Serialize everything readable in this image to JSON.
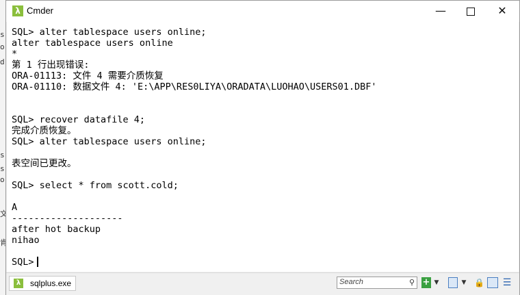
{
  "window": {
    "title": "Cmder",
    "app_icon_glyph": "λ",
    "minimize_glyph": "—",
    "close_glyph": "✕"
  },
  "console": {
    "lines": [
      "SQL> alter tablespace users online;",
      "alter tablespace users online",
      "*",
      "第 1 行出现错误:",
      "ORA-01113: 文件 4 需要介质恢复",
      "ORA-01110: 数据文件 4: 'E:\\APP\\RES0LIYA\\ORADATA\\LUOHAO\\USERS01.DBF'",
      "",
      "",
      "SQL> recover datafile 4;",
      "完成介质恢复。",
      "SQL> alter tablespace users online;",
      "",
      "表空间已更改。",
      "",
      "SQL> select * from scott.cold;",
      "",
      "A",
      "--------------------",
      "after hot backup",
      "nihao",
      ""
    ],
    "prompt": "SQL>"
  },
  "statusbar": {
    "tab_label": "sqlplus.exe",
    "tab_icon_glyph": "λ",
    "search_placeholder": "Search"
  },
  "background": {
    "edge_chars": [
      "s",
      "o",
      "d",
      "s",
      "s",
      "o",
      "文",
      "肯"
    ]
  },
  "colors": {
    "accent": "#8bbf3d",
    "console_bg": "#ffffff",
    "console_text": "#000000"
  }
}
